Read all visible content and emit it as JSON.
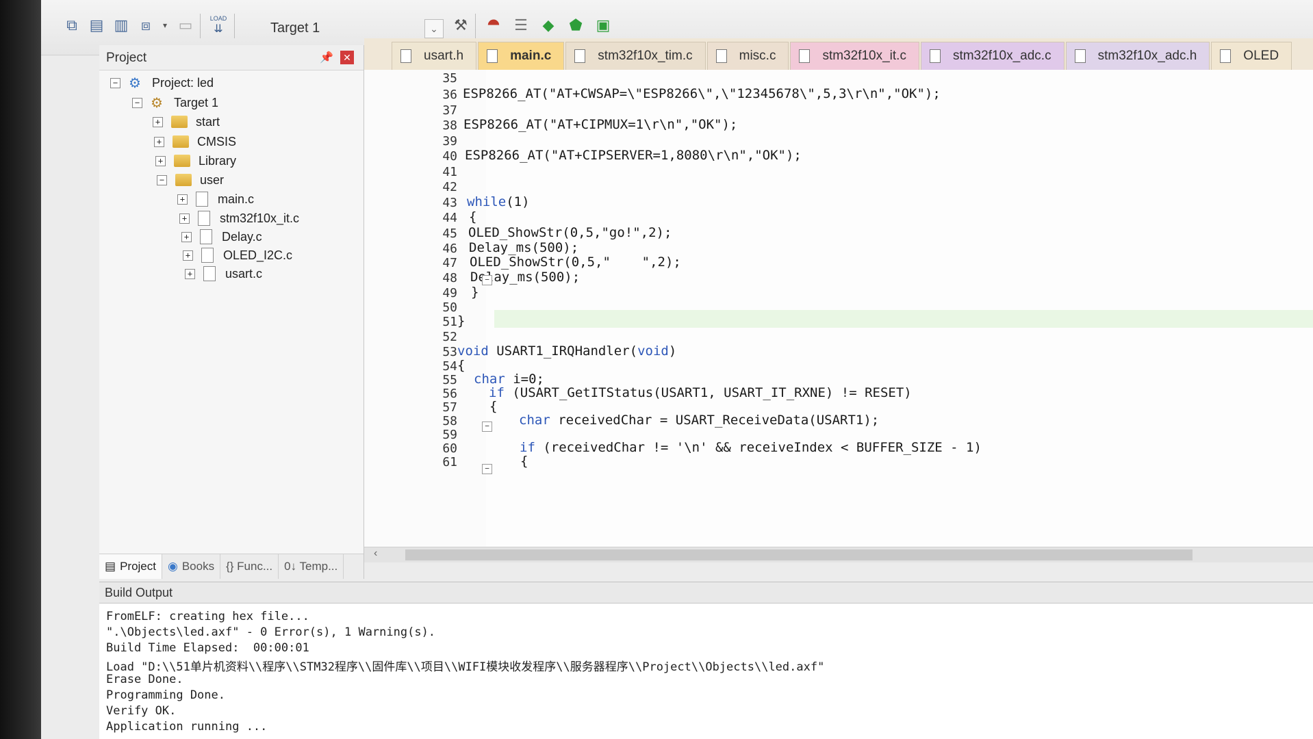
{
  "toolbar": {
    "target_label": "Target 1",
    "load_label": "LOAD",
    "icons": [
      "translate-icon",
      "build-icon",
      "rebuild-icon",
      "batch-build-icon",
      "stop-build-icon",
      "download-icon",
      "options-icon",
      "manage-components-icon",
      "select-packs-icon",
      "pack-installer-icon",
      "run-time-env-icon"
    ]
  },
  "project_panel": {
    "title": "Project",
    "tree": [
      {
        "label": "Project: led",
        "level": 0,
        "type": "project",
        "expander": "−"
      },
      {
        "label": "Target 1",
        "level": 1,
        "type": "target",
        "expander": "−"
      },
      {
        "label": "start",
        "level": 2,
        "type": "folder",
        "expander": "+"
      },
      {
        "label": "CMSIS",
        "level": 2,
        "type": "folder",
        "expander": "+"
      },
      {
        "label": "Library",
        "level": 2,
        "type": "folder",
        "expander": "+"
      },
      {
        "label": "user",
        "level": 2,
        "type": "folder",
        "expander": "−"
      },
      {
        "label": "main.c",
        "level": 3,
        "type": "file",
        "expander": "+"
      },
      {
        "label": "stm32f10x_it.c",
        "level": 3,
        "type": "file",
        "expander": "+"
      },
      {
        "label": "Delay.c",
        "level": 3,
        "type": "file",
        "expander": "+"
      },
      {
        "label": "OLED_I2C.c",
        "level": 3,
        "type": "file",
        "expander": "+"
      },
      {
        "label": "usart.c",
        "level": 3,
        "type": "file",
        "expander": "+"
      }
    ],
    "bottom_tabs": [
      "Project",
      "Books",
      "{} Func...",
      "0↓ Temp..."
    ]
  },
  "editor_tabs": [
    "usart.h",
    "main.c",
    "stm32f10x_tim.c",
    "misc.c",
    "stm32f10x_it.c",
    "stm32f10x_adc.c",
    "stm32f10x_adc.h",
    "OLED"
  ],
  "code_lines": [
    {
      "n": "35",
      "text": ""
    },
    {
      "n": "36",
      "text": "ESP8266_AT(\"AT+CWSAP=\\\"ESP8266\\\",\\\"12345678\\\",5,3\\r\\n\",\"OK\");"
    },
    {
      "n": "37",
      "text": ""
    },
    {
      "n": "38",
      "text": "ESP8266_AT(\"AT+CIPMUX=1\\r\\n\",\"OK\");"
    },
    {
      "n": "39",
      "text": ""
    },
    {
      "n": "40",
      "text": "ESP8266_AT(\"AT+CIPSERVER=1,8080\\r\\n\",\"OK\");"
    },
    {
      "n": "41",
      "text": ""
    },
    {
      "n": "42",
      "text": ""
    },
    {
      "n": "43",
      "text": "while(1)"
    },
    {
      "n": "44",
      "text": "{"
    },
    {
      "n": "45",
      "text": "OLED_ShowStr(0,5,\"go!\",2);"
    },
    {
      "n": "46",
      "text": "Delay_ms(500);"
    },
    {
      "n": "47",
      "text": "OLED_ShowStr(0,5,\"    \",2);"
    },
    {
      "n": "48",
      "text": "Delay_ms(500);"
    },
    {
      "n": "49",
      "text": "}"
    },
    {
      "n": "50",
      "text": ""
    },
    {
      "n": "51",
      "text": "}"
    },
    {
      "n": "52",
      "text": ""
    },
    {
      "n": "53",
      "text": "void USART1_IRQHandler(void)"
    },
    {
      "n": "54",
      "text": "{"
    },
    {
      "n": "55",
      "text": "char i=0;"
    },
    {
      "n": "56",
      "text": "if (USART_GetITStatus(USART1, USART_IT_RXNE) != RESET)"
    },
    {
      "n": "57",
      "text": "{"
    },
    {
      "n": "58",
      "text": "char receivedChar = USART_ReceiveData(USART1);"
    },
    {
      "n": "59",
      "text": ""
    },
    {
      "n": "60",
      "text": "if (receivedChar != '\\n' && receiveIndex < BUFFER_SIZE - 1)"
    },
    {
      "n": "61",
      "text": "{"
    }
  ],
  "build_output": {
    "title": "Build Output",
    "lines": [
      "FromELF: creating hex file...",
      "\".\\Objects\\led.axf\" - 0 Error(s), 1 Warning(s).",
      "Build Time Elapsed:  00:00:01",
      "Load \"D:\\\\51单片机资料\\\\程序\\\\STM32程序\\\\固件库\\\\项目\\\\WIFI模块收发程序\\\\服务器程序\\\\Project\\\\Objects\\\\led.axf\"",
      "Erase Done.",
      "Programming Done.",
      "Verify OK.",
      "Application running ..."
    ]
  }
}
